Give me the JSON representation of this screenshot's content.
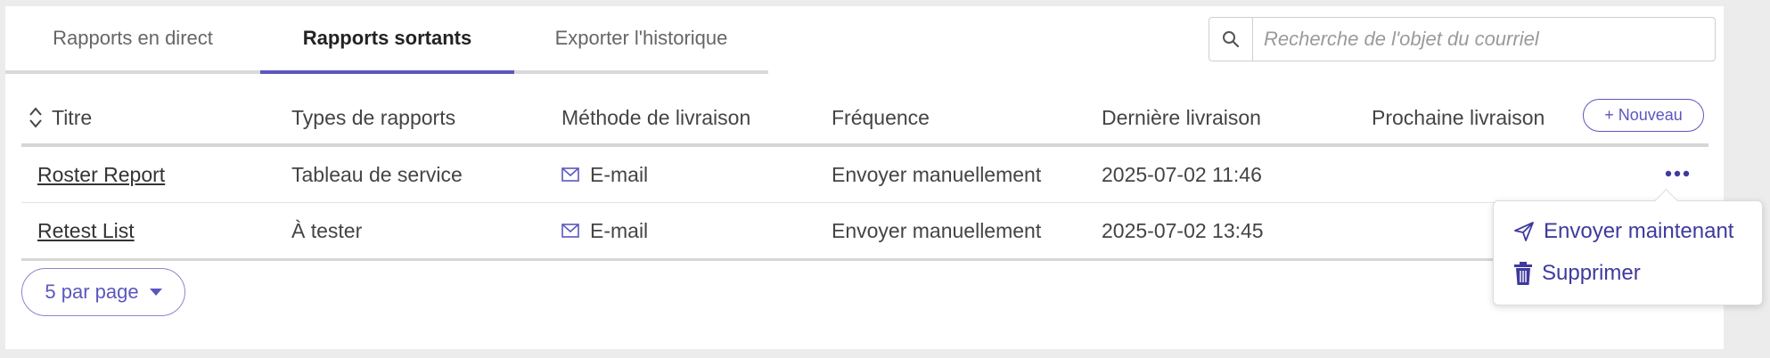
{
  "tabs": [
    {
      "label": "Rapports en direct",
      "active": false
    },
    {
      "label": "Rapports sortants",
      "active": true
    },
    {
      "label": "Exporter l'historique",
      "active": false
    }
  ],
  "search": {
    "placeholder": "Recherche de l'objet du courriel",
    "value": ""
  },
  "table": {
    "headers": [
      "Titre",
      "Types de rapports",
      "Méthode de livraison",
      "Fréquence",
      "Dernière livraison",
      "Prochaine livraison"
    ],
    "new_button_label": "+ Nouveau",
    "rows": [
      {
        "title": "Roster Report",
        "type": "Tableau de service",
        "method": "E-mail",
        "frequency": "Envoyer manuellement",
        "last": "2025-07-02 11:46",
        "next": ""
      },
      {
        "title": "Retest List",
        "type": "À tester",
        "method": "E-mail",
        "frequency": "Envoyer manuellement",
        "last": "2025-07-02 13:45",
        "next": ""
      }
    ]
  },
  "pagination": {
    "per_page_label": "5 par page"
  },
  "menu": {
    "items": [
      {
        "label": "Envoyer maintenant",
        "icon": "paper-plane-icon"
      },
      {
        "label": "Supprimer",
        "icon": "trash-icon"
      }
    ]
  },
  "colors": {
    "accent": "#5b57bf",
    "menu_text": "#3f3a9e"
  }
}
